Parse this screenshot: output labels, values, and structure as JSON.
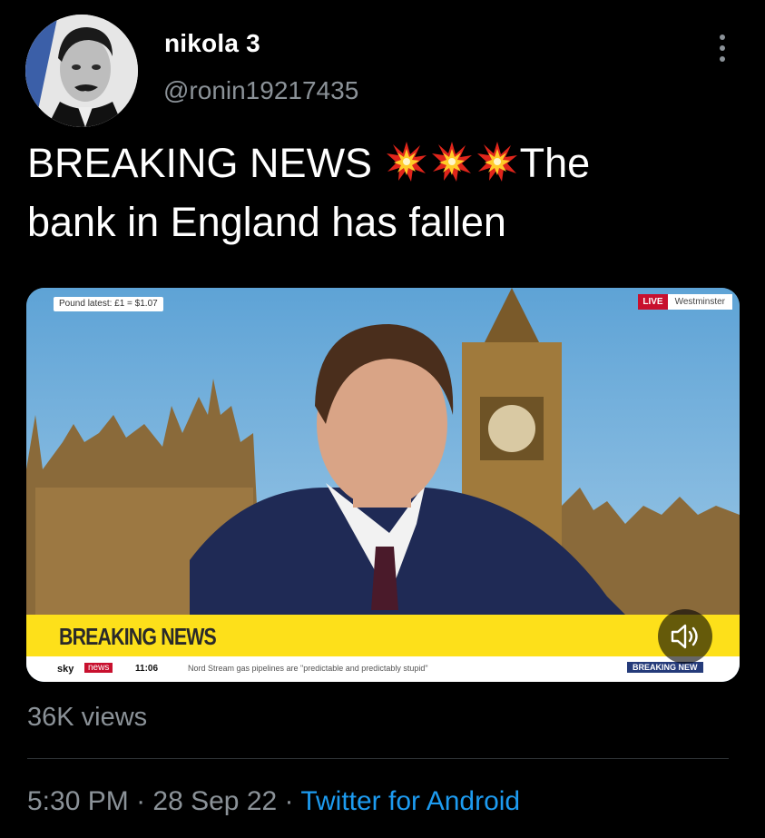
{
  "author": {
    "display_name": "nikola 3",
    "handle": "@ronin19217435"
  },
  "tweet": {
    "text_lead": "BREAKING NEWS",
    "text_after_emoji": "The",
    "text_line2": "bank in England has fallen",
    "emoji_icon": "collision-icon",
    "emoji_count": 3
  },
  "video": {
    "pound_tag": "Pound latest: £1 = $1.07",
    "live_label": "LIVE",
    "location_label": "Westminster",
    "banner_text": "BREAKING NEWS",
    "channel_sky": "sky",
    "channel_news": "news",
    "clock": "11:06",
    "ticker_text": "Nord Stream gas pipelines are \"predictable and predictably stupid\"",
    "ticker_end": "BREAKING NEW",
    "banner_color": "#fde01a",
    "live_color": "#c8102e"
  },
  "stats": {
    "views": "36K views"
  },
  "meta": {
    "time": "5:30 PM",
    "separator": " · ",
    "date": "28 Sep 22",
    "source": "Twitter for Android",
    "source_color": "#1d9bf0"
  }
}
